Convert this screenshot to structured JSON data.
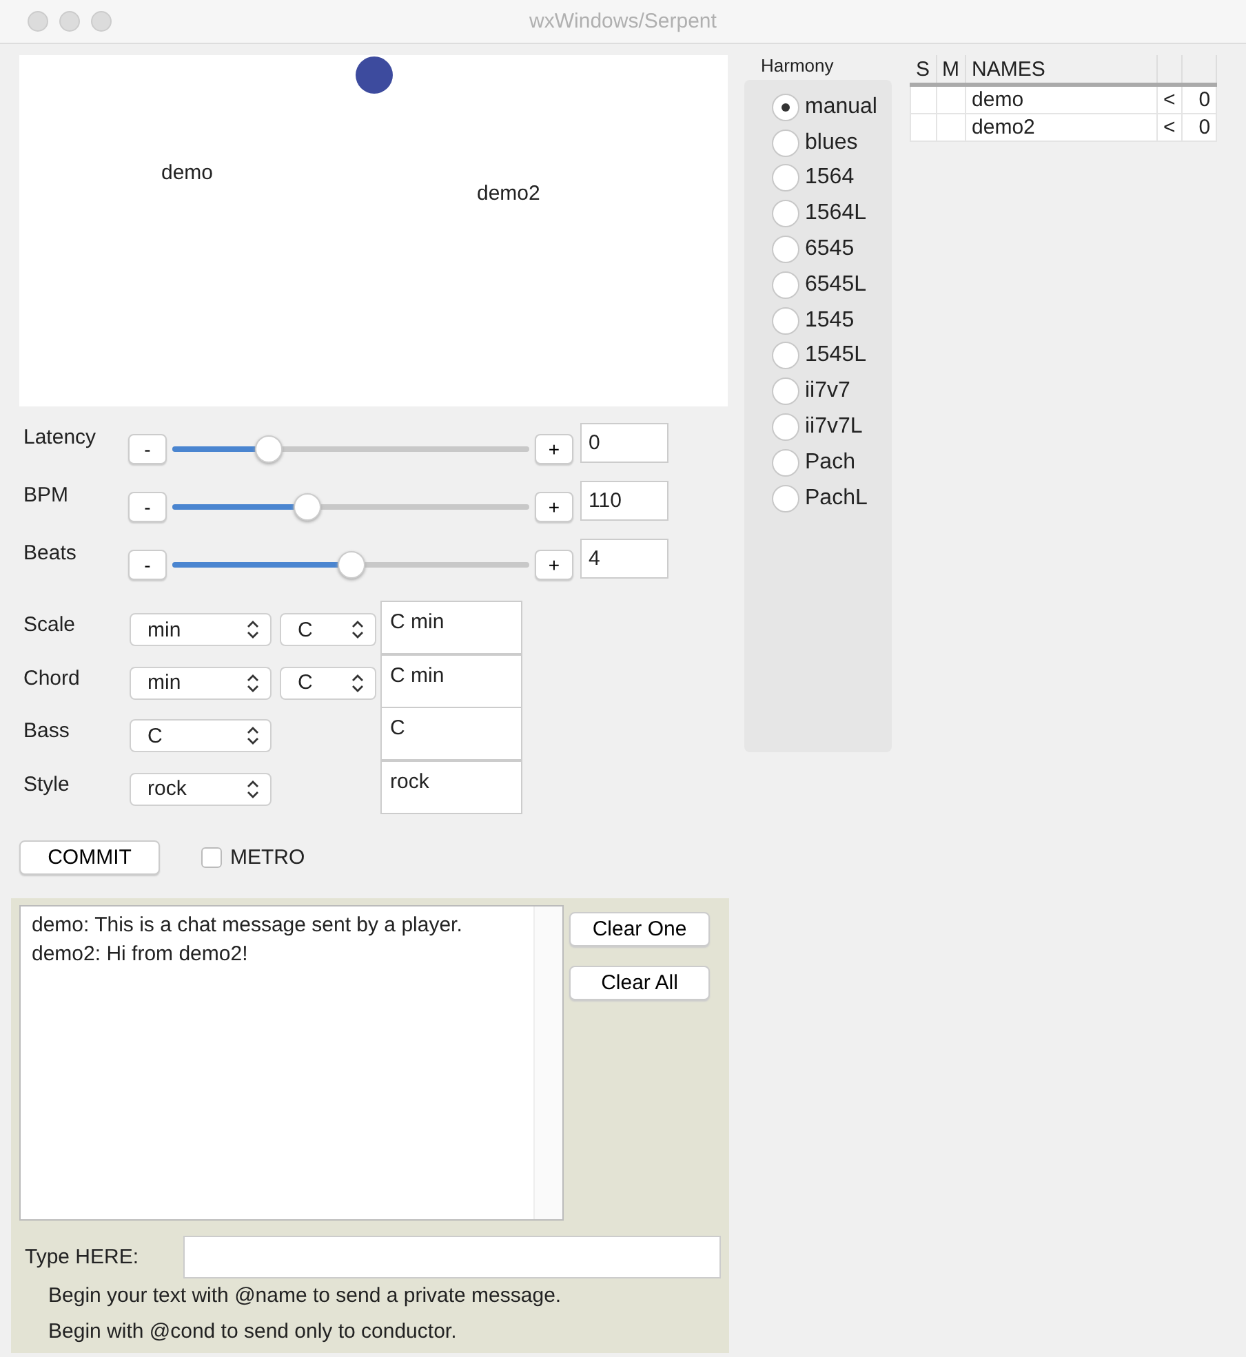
{
  "window": {
    "title": "wxWindows/Serpent"
  },
  "canvas": {
    "labels": [
      "demo",
      "demo2"
    ]
  },
  "sliders": [
    {
      "label": "Latency",
      "minus": "-",
      "plus": "+",
      "level": 0.27,
      "value": "0"
    },
    {
      "label": "BPM",
      "minus": "-",
      "plus": "+",
      "level": 0.38,
      "value": "110"
    },
    {
      "label": "Beats",
      "minus": "-",
      "plus": "+",
      "level": 0.5,
      "value": "4"
    }
  ],
  "selectors": [
    {
      "label": "Scale",
      "choices": [
        "min",
        "C"
      ],
      "result": "C min"
    },
    {
      "label": "Chord",
      "choices": [
        "min",
        "C"
      ],
      "result": "C min"
    },
    {
      "label": "Bass",
      "choices": [
        "C"
      ],
      "result": "C"
    },
    {
      "label": "Style",
      "choices": [
        "rock"
      ],
      "result": "rock"
    }
  ],
  "commit": "COMMIT",
  "metro": {
    "label": "METRO",
    "checked": false
  },
  "harmony": {
    "title": "Harmony",
    "options": [
      {
        "label": "manual",
        "selected": true
      },
      {
        "label": "blues",
        "selected": false
      },
      {
        "label": "1564",
        "selected": false
      },
      {
        "label": "1564L",
        "selected": false
      },
      {
        "label": "6545",
        "selected": false
      },
      {
        "label": "6545L",
        "selected": false
      },
      {
        "label": "1545",
        "selected": false
      },
      {
        "label": "1545L",
        "selected": false
      },
      {
        "label": "ii7v7",
        "selected": false
      },
      {
        "label": "ii7v7L",
        "selected": false
      },
      {
        "label": "Pach",
        "selected": false
      },
      {
        "label": "PachL",
        "selected": false
      }
    ]
  },
  "table": {
    "columns": [
      "S",
      "M",
      "NAMES"
    ],
    "rows": [
      {
        "name": "demo",
        "column_4": "<",
        "column_5": "0"
      },
      {
        "name": "demo2",
        "column_4": "<",
        "column_5": "0"
      }
    ]
  },
  "chat": {
    "messages": [
      "demo: This is a chat message sent by a player.",
      "demo2: Hi from demo2!"
    ],
    "buttons": [
      "Clear One",
      "Clear All"
    ],
    "input_label": "Type HERE:",
    "hints": [
      "Begin your text with @name to send a private message.",
      "Begin with @cond to send only to conductor."
    ]
  }
}
